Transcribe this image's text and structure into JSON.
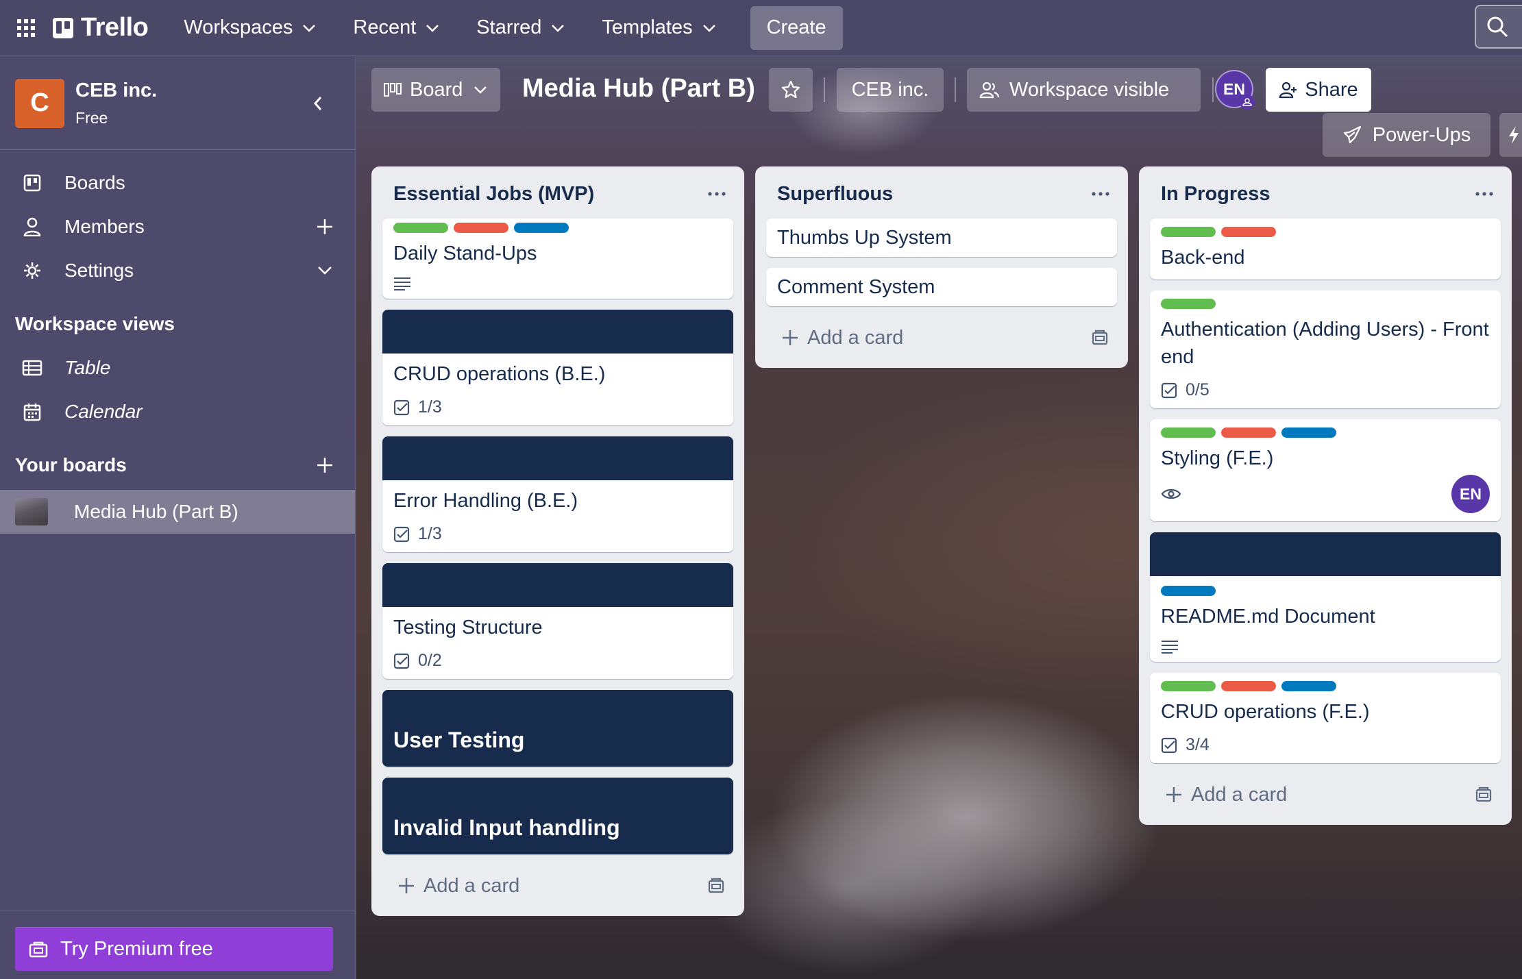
{
  "topnav": {
    "brand": "Trello",
    "menus": [
      "Workspaces",
      "Recent",
      "Starred",
      "Templates"
    ],
    "create_label": "Create"
  },
  "sidebar": {
    "workspace_initial": "C",
    "workspace_name": "CEB inc.",
    "workspace_plan": "Free",
    "items": [
      {
        "label": "Boards"
      },
      {
        "label": "Members"
      },
      {
        "label": "Settings"
      }
    ],
    "views_heading": "Workspace views",
    "views": [
      {
        "label": "Table"
      },
      {
        "label": "Calendar"
      }
    ],
    "boards_heading": "Your boards",
    "boards": [
      {
        "label": "Media Hub (Part B)"
      }
    ],
    "premium_label": "Try Premium free"
  },
  "board_header": {
    "view_label": "Board",
    "title": "Media Hub (Part B)",
    "workspace_label": "CEB inc.",
    "visibility_label": "Workspace visible",
    "member_initials": "EN",
    "share_label": "Share",
    "powerups_label": "Power-Ups"
  },
  "lists": [
    {
      "title": "Essential Jobs (MVP)",
      "add_label": "Add a card",
      "cards": [
        {
          "title": "Daily Stand-Ups",
          "labels": [
            "green",
            "red",
            "blue"
          ],
          "has_description": true
        },
        {
          "title": "CRUD operations (B.E.)",
          "cover": true,
          "checklist": "1/3"
        },
        {
          "title": "Error Handling (B.E.)",
          "cover": true,
          "checklist": "1/3"
        },
        {
          "title": "Testing Structure",
          "cover": true,
          "checklist": "0/2"
        },
        {
          "title": "User Testing",
          "full_cover": true
        },
        {
          "title": "Invalid Input handling",
          "full_cover": true
        }
      ]
    },
    {
      "title": "Superfluous",
      "add_label": "Add a card",
      "cards": [
        {
          "title": "Thumbs Up System"
        },
        {
          "title": "Comment System"
        }
      ]
    },
    {
      "title": "In Progress",
      "add_label": "Add a card",
      "cards": [
        {
          "title": "Back-end",
          "labels": [
            "green",
            "red"
          ]
        },
        {
          "title": "Authentication (Adding Users) - Front end",
          "labels": [
            "green"
          ],
          "checklist": "0/5"
        },
        {
          "title": "Styling (F.E.)",
          "labels": [
            "green",
            "red",
            "blue"
          ],
          "watching": true,
          "member": "EN"
        },
        {
          "title": "README.md Document",
          "cover": true,
          "labels": [
            "blue"
          ],
          "has_description": true
        },
        {
          "title": "CRUD operations (F.E.)",
          "labels": [
            "green",
            "red",
            "blue"
          ],
          "checklist": "3/4"
        }
      ]
    }
  ],
  "colors": {
    "label_green": "#61bd4f",
    "label_red": "#eb5a46",
    "label_blue": "#0079bf",
    "cover_navy": "#172b4d",
    "workspace_orange": "#d9622b",
    "premium_purple": "#8f3ed7"
  }
}
